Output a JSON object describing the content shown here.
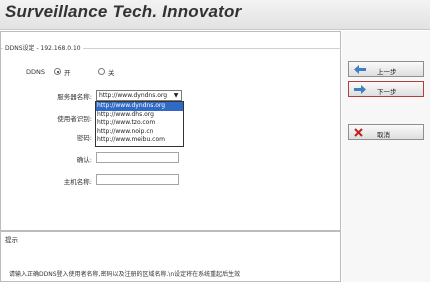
{
  "header": {
    "brand": "Surveillance Tech. Innovator"
  },
  "section": {
    "legend": "DDNS设定 - 192.168.0.10"
  },
  "ddns": {
    "label": "DDNS",
    "on_label": "开",
    "off_label": "关",
    "selected": "on"
  },
  "form": {
    "server_label": "服务器名称:",
    "server_value": "http://www.dyndns.org",
    "server_options": [
      "http://www.dyndns.org",
      "http://www.dhs.org",
      "http://www.tzo.com",
      "http://www.noip.cn",
      "http://www.meibu.com"
    ],
    "user_label": "使用者识别:",
    "password_label": "密码:",
    "confirm_label": "确认:",
    "hostname_label": "主机名称:"
  },
  "hint": {
    "title": "提示",
    "text": "请输入正确DDNS登入使用者名称,密码以及注册的区域名称.\\n设定将在系统重起后生效"
  },
  "buttons": {
    "prev_label": "上一步",
    "next_label": "下一步",
    "cancel_label": "取消"
  },
  "colors": {
    "selection": "#316ac5",
    "next_border": "#b04040"
  }
}
